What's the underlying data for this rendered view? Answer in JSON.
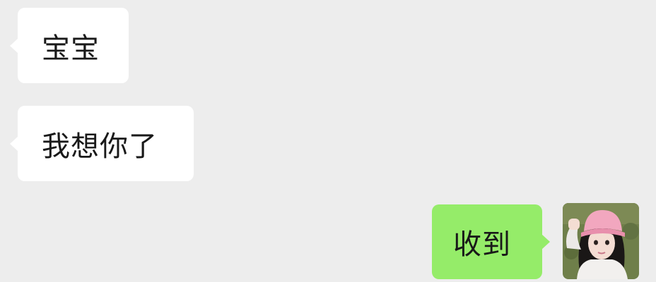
{
  "messages": [
    {
      "direction": "incoming",
      "text": "宝宝"
    },
    {
      "direction": "incoming",
      "text": "我想你了"
    },
    {
      "direction": "outgoing",
      "text": "收到"
    }
  ],
  "avatar_icon": "user-avatar-photo-icon",
  "colors": {
    "background": "#ededed",
    "incoming_bubble": "#ffffff",
    "outgoing_bubble": "#95ec69",
    "text": "#191919"
  }
}
